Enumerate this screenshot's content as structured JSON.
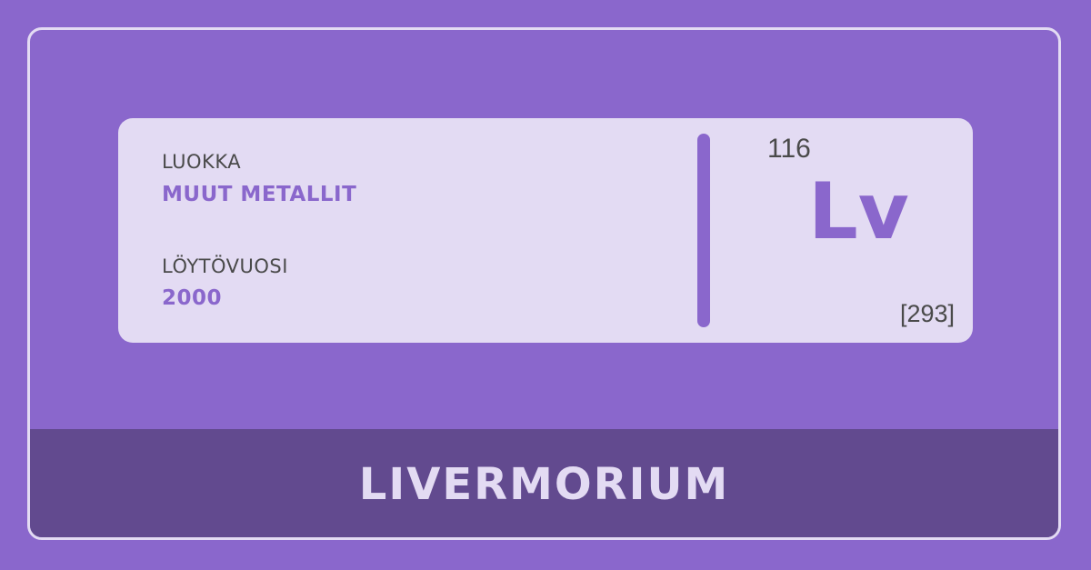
{
  "element": {
    "category_label": "LUOKKA",
    "category_value": "MUUT METALLIT",
    "discovery_label": "LÖYTÖVUOSI",
    "discovery_year": "2000",
    "atomic_number": "116",
    "symbol": "Lv",
    "atomic_mass": "[293]",
    "name": "LIVERMORIUM"
  },
  "colors": {
    "background": "#8a67cc",
    "card": "#e3dbf3",
    "accent": "#8a67cc",
    "footer": "#624a8f",
    "text": "#4a4a4a"
  }
}
